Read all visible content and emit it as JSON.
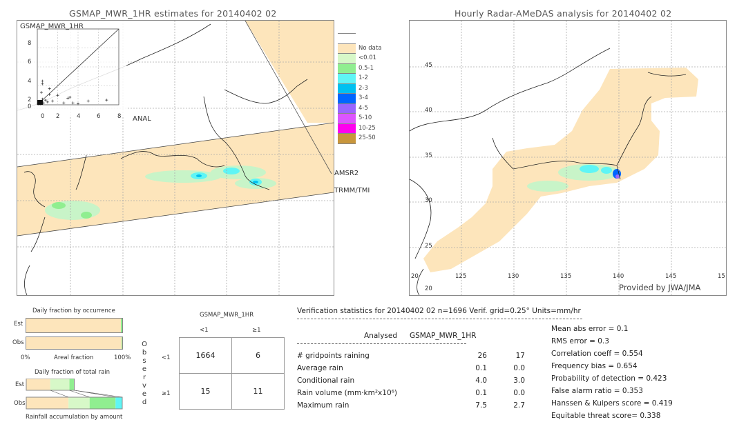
{
  "left_map": {
    "title": "GSMAP_MWR_1HR estimates for 20140402 02",
    "scatter_title": "GSMAP_MWR_1HR",
    "scatter_xlabel": "ANAL",
    "scatter_ticks": [
      "0",
      "2",
      "4",
      "6",
      "8"
    ],
    "swath_labels": [
      "AMSR2",
      "TRMM/TMI"
    ]
  },
  "right_map": {
    "title": "Hourly Radar-AMeDAS analysis for 20140402 02",
    "lat_labels": [
      "45",
      "40",
      "35",
      "30",
      "25",
      "20"
    ],
    "lon_labels": [
      "20",
      "125",
      "130",
      "135",
      "140",
      "145",
      "15"
    ],
    "credit": "Provided by JWA/JMA"
  },
  "legend": {
    "items": [
      {
        "label": "",
        "color": "#ffffff"
      },
      {
        "label": "No data",
        "color": "#fde5bb"
      },
      {
        "label": "<0.01",
        "color": "#d7f8c8"
      },
      {
        "label": "0.5-1",
        "color": "#90ee90"
      },
      {
        "label": "1-2",
        "color": "#5ff5f5"
      },
      {
        "label": "2-3",
        "color": "#00c0f0"
      },
      {
        "label": "3-4",
        "color": "#0066ff"
      },
      {
        "label": "4-5",
        "color": "#9966ff"
      },
      {
        "label": "5-10",
        "color": "#dd55ff"
      },
      {
        "label": "10-25",
        "color": "#ff00ee"
      },
      {
        "label": "25-50",
        "color": "#c8963c"
      }
    ]
  },
  "occurrence": {
    "title": "Daily fraction by occurrence",
    "rows": [
      "Est",
      "Obs"
    ],
    "x_left": "0%",
    "x_mid": "Areal fraction",
    "x_right": "100%"
  },
  "total_rain": {
    "title": "Daily fraction of total rain",
    "rows": [
      "Est",
      "Obs"
    ],
    "footer": "Rainfall accumulation by amount"
  },
  "contingency": {
    "header": "GSMAP_MWR_1HR",
    "col_labels": [
      "<1",
      "≥1"
    ],
    "row_labels": [
      "<1",
      "≥1"
    ],
    "side_label": "Observed",
    "cells": [
      [
        "1664",
        "6"
      ],
      [
        "15",
        "11"
      ]
    ]
  },
  "verification": {
    "header": "Verification statistics for 20140402 02   n=1696   Verif. grid=0.25°   Units=mm/hr",
    "col_analysed": "Analysed",
    "col_est": "GSMAP_MWR_1HR",
    "rows": [
      {
        "label": "# gridpoints raining",
        "analysed": "26",
        "est": "17"
      },
      {
        "label": "Average rain",
        "analysed": "0.1",
        "est": "0.0"
      },
      {
        "label": "Conditional rain",
        "analysed": "4.0",
        "est": "3.0"
      },
      {
        "label": "Rain volume (mm·km²x10⁶)",
        "analysed": "0.1",
        "est": "0.0"
      },
      {
        "label": "Maximum rain",
        "analysed": "7.5",
        "est": "2.7"
      }
    ],
    "scores": [
      "Mean abs error = 0.1",
      "RMS error = 0.3",
      "Correlation coeff = 0.554",
      "Frequency bias = 0.654",
      "Probability of detection = 0.423",
      "False alarm ratio = 0.353",
      "Hanssen & Kuipers score = 0.419",
      "Equitable threat score= 0.338"
    ]
  },
  "chart_data": [
    {
      "type": "scatter",
      "title": "GSMAP_MWR_1HR",
      "xlabel": "ANAL",
      "ylabel": "GSMAP_MWR_1HR",
      "xlim": [
        0,
        8
      ],
      "ylim": [
        0,
        8
      ],
      "diagonal": true,
      "points": [
        [
          0.1,
          0.1
        ],
        [
          0.2,
          0.3
        ],
        [
          0.3,
          0.1
        ],
        [
          0.5,
          0.6
        ],
        [
          0.6,
          0.2
        ],
        [
          0.8,
          0.5
        ],
        [
          1.0,
          0.3
        ],
        [
          1.2,
          1.1
        ],
        [
          1.5,
          0.4
        ],
        [
          2.0,
          1.0
        ],
        [
          2.6,
          0.2
        ],
        [
          3.2,
          0.8
        ],
        [
          3.5,
          0.2
        ],
        [
          4.0,
          0.1
        ],
        [
          5.0,
          0.4
        ],
        [
          6.8,
          0.5
        ],
        [
          0.5,
          2.5
        ],
        [
          0.5,
          2.2
        ],
        [
          1.2,
          1.7
        ],
        [
          0.4,
          1.3
        ],
        [
          3.0,
          0.7
        ]
      ]
    },
    {
      "type": "bar",
      "title": "Daily fraction by occurrence",
      "categories": [
        "Est",
        "Obs"
      ],
      "series": [
        {
          "name": "No data",
          "values": [
            0.99,
            0.995
          ]
        },
        {
          "name": "<0.01",
          "values": [
            0.01,
            0.005
          ]
        }
      ],
      "xlabel": "Areal fraction",
      "xlim": [
        0,
        1
      ]
    },
    {
      "type": "bar",
      "title": "Daily fraction of total rain",
      "categories": [
        "Est",
        "Obs"
      ],
      "series": [
        {
          "name": "No data",
          "values": [
            0.25,
            0.44
          ]
        },
        {
          "name": "<0.01",
          "values": [
            0.2,
            0.22
          ]
        },
        {
          "name": "0.5-1",
          "values": [
            0.05,
            0.27
          ]
        },
        {
          "name": "1-2",
          "values": [
            0.0,
            0.07
          ]
        }
      ],
      "xlabel": "Rainfall accumulation by amount",
      "xlim": [
        0,
        1
      ]
    }
  ]
}
